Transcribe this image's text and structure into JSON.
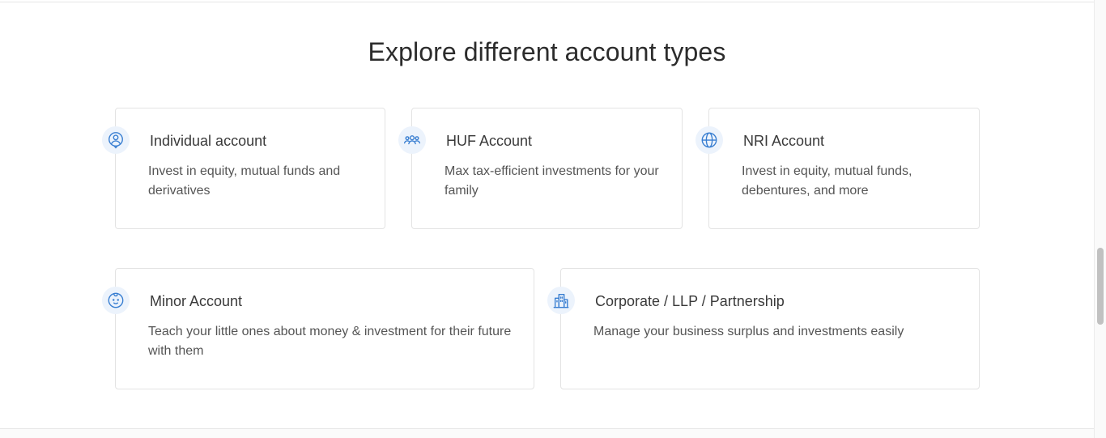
{
  "section": {
    "title": "Explore different account types"
  },
  "cards": [
    {
      "title": "Individual account",
      "description": "Invest in equity, mutual funds and derivatives",
      "icon": "user-circle-icon"
    },
    {
      "title": "HUF Account",
      "description": "Max tax-efficient investments for your family",
      "icon": "family-group-icon"
    },
    {
      "title": "NRI Account",
      "description": "Invest in equity, mutual funds, debentures, and more",
      "icon": "globe-icon"
    },
    {
      "title": "Minor Account",
      "description": "Teach your little ones about money & investment for their future with them",
      "icon": "baby-face-icon"
    },
    {
      "title": "Corporate / LLP / Partnership",
      "description": "Manage your business surplus and investments easily",
      "icon": "office-building-icon"
    }
  ],
  "colors": {
    "icon_accent": "#387ed1",
    "icon_background": "#ecf3fc",
    "card_border": "#e3e3e3",
    "title_text": "#2c2c2c"
  }
}
